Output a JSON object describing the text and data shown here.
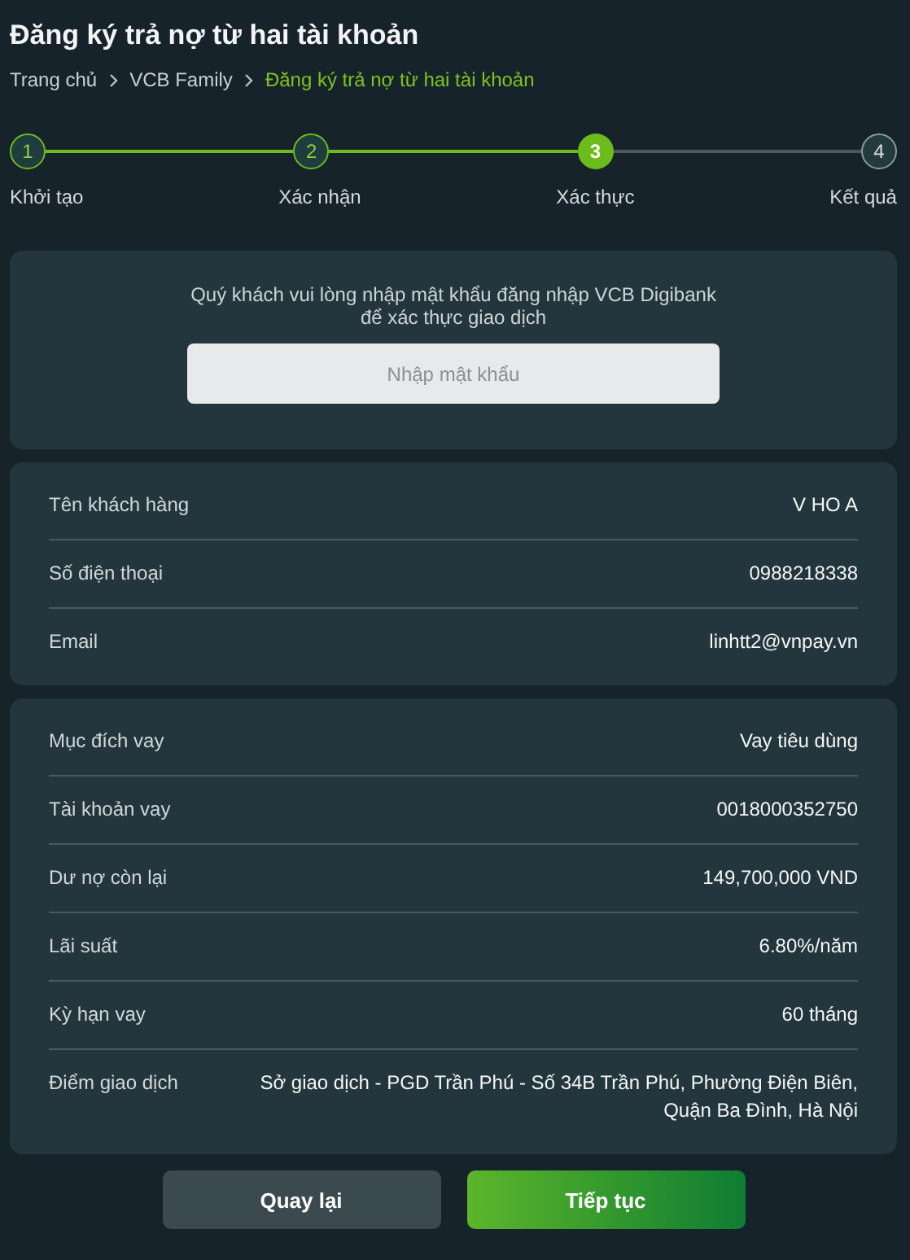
{
  "title": "Đăng ký trả nợ từ hai tài khoản",
  "breadcrumb": [
    {
      "label": "Trang chủ",
      "current": false
    },
    {
      "label": "VCB Family",
      "current": false
    },
    {
      "label": "Đăng ký trả nợ từ hai tài khoản",
      "current": true
    }
  ],
  "steps": [
    {
      "number": "1",
      "label": "Khởi tạo",
      "completed": true,
      "selected": false
    },
    {
      "number": "2",
      "label": "Xác nhận",
      "completed": true,
      "selected": false
    },
    {
      "number": "3",
      "label": "Xác thực",
      "completed": false,
      "selected": true
    },
    {
      "number": "4",
      "label": "Kết quả",
      "completed": false,
      "selected": false
    }
  ],
  "auth": {
    "message": "Quý khách vui lòng nhập mật khẩu đăng nhập VCB Digibank để xác thực giao dịch",
    "password": {
      "placeholder": "Nhập mật khẩu"
    }
  },
  "customer": [
    {
      "label": "Tên khách hàng",
      "value": "V HO A"
    },
    {
      "label": "Số điện thoại",
      "value": "0988218338"
    },
    {
      "label": "Email",
      "value": "linhtt2@vnpay.vn"
    }
  ],
  "loan": [
    {
      "label": "Mục đích vay",
      "value": "Vay tiêu dùng"
    },
    {
      "label": "Tài khoản vay",
      "value": "0018000352750"
    },
    {
      "label": "Dư nợ còn lại",
      "value": "149,700,000 VND"
    },
    {
      "label": "Lãi suất",
      "value": "6.80%/năm"
    },
    {
      "label": "Kỳ hạn vay",
      "value": "60 tháng"
    },
    {
      "label": "Điểm giao dịch",
      "value": "Sở giao dịch - PGD Trần Phú - Số 34B Trần Phú, Phường Điện Biên, Quận Ba Đình, Hà Nội"
    }
  ],
  "buttons": [
    {
      "label": "Quay lại",
      "kind": "secondary"
    },
    {
      "label": "Tiếp tục",
      "kind": "primary"
    }
  ]
}
